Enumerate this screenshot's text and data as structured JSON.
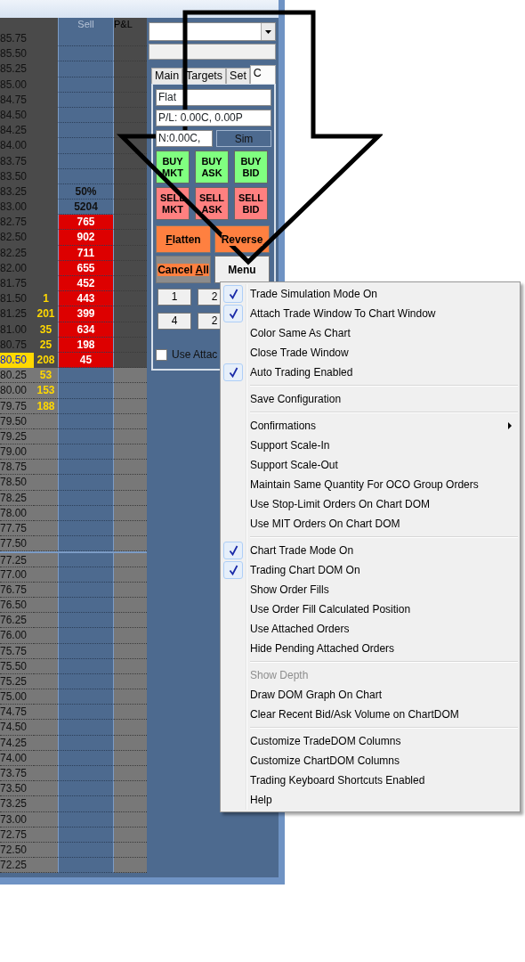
{
  "ladder": {
    "columns": [
      {
        "label": "Sell"
      },
      {
        "label": "P&L"
      }
    ],
    "rows": [
      {
        "price": "85.75",
        "current": false,
        "highlight": false,
        "divider": false
      },
      {
        "price": "85.50",
        "current": false,
        "highlight": false,
        "divider": false
      },
      {
        "price": "85.25",
        "current": false,
        "highlight": false,
        "divider": false
      },
      {
        "price": "85.00",
        "current": false,
        "highlight": false,
        "divider": false
      },
      {
        "price": "84.75",
        "current": false,
        "highlight": false,
        "divider": false
      },
      {
        "price": "84.50",
        "current": false,
        "highlight": false,
        "divider": false
      },
      {
        "price": "84.25",
        "current": false,
        "highlight": false,
        "divider": false
      },
      {
        "price": "84.00",
        "current": false,
        "highlight": false,
        "divider": false
      },
      {
        "price": "83.75",
        "current": false,
        "highlight": false,
        "divider": false
      },
      {
        "price": "83.50",
        "current": false,
        "highlight": false,
        "divider": false
      },
      {
        "price": "83.25",
        "sell": "50%",
        "current": false,
        "highlight": false,
        "divider": false
      },
      {
        "price": "83.00",
        "sell": "5204",
        "current": false,
        "highlight": false,
        "divider": false
      },
      {
        "price": "82.75",
        "sell": "765",
        "current": false,
        "highlight": true,
        "divider": false
      },
      {
        "price": "82.50",
        "sell": "902",
        "current": false,
        "highlight": true,
        "divider": false
      },
      {
        "price": "82.25",
        "sell": "711",
        "current": false,
        "highlight": true,
        "divider": false
      },
      {
        "price": "82.00",
        "sell": "655",
        "current": false,
        "highlight": true,
        "divider": false
      },
      {
        "price": "81.75",
        "sell": "452",
        "current": false,
        "highlight": true,
        "divider": false
      },
      {
        "price": "81.50",
        "bid": "1",
        "sell": "443",
        "current": false,
        "highlight": true,
        "divider": false
      },
      {
        "price": "81.25",
        "bid": "201",
        "sell": "399",
        "current": false,
        "highlight": true,
        "divider": false
      },
      {
        "price": "81.00",
        "bid": "35",
        "sell": "634",
        "current": false,
        "highlight": true,
        "divider": false
      },
      {
        "price": "80.75",
        "bid": "25",
        "sell": "198",
        "current": false,
        "highlight": true,
        "divider": false
      },
      {
        "price": "80.50",
        "bid": "208",
        "sell": "45",
        "current": true,
        "highlight": true,
        "divider": false
      },
      {
        "price": "80.25",
        "bid": "53",
        "current": false,
        "highlight": false,
        "divider": false
      },
      {
        "price": "80.00",
        "bid": "153",
        "current": false,
        "highlight": false,
        "divider": false
      },
      {
        "price": "79.75",
        "bid": "188",
        "current": false,
        "highlight": false,
        "divider": false
      },
      {
        "price": "79.50",
        "current": false,
        "highlight": false,
        "divider": false
      },
      {
        "price": "79.25",
        "current": false,
        "highlight": false,
        "divider": false
      },
      {
        "price": "79.00",
        "current": false,
        "highlight": false,
        "divider": false
      },
      {
        "price": "78.75",
        "current": false,
        "highlight": false,
        "divider": false
      },
      {
        "price": "78.50",
        "current": false,
        "highlight": false,
        "divider": false
      },
      {
        "price": "78.25",
        "current": false,
        "highlight": false,
        "divider": false
      },
      {
        "price": "78.00",
        "current": false,
        "highlight": false,
        "divider": false
      },
      {
        "price": "77.75",
        "current": false,
        "highlight": false,
        "divider": false
      },
      {
        "price": "77.50",
        "current": false,
        "highlight": false,
        "divider": false
      },
      {
        "price": "77.25",
        "current": false,
        "highlight": false,
        "divider": true
      },
      {
        "price": "77.00",
        "current": false,
        "highlight": false,
        "divider": false
      },
      {
        "price": "76.75",
        "current": false,
        "highlight": false,
        "divider": false
      },
      {
        "price": "76.50",
        "current": false,
        "highlight": false,
        "divider": false
      },
      {
        "price": "76.25",
        "current": false,
        "highlight": false,
        "divider": false
      },
      {
        "price": "76.00",
        "current": false,
        "highlight": false,
        "divider": false
      },
      {
        "price": "75.75",
        "current": false,
        "highlight": false,
        "divider": false
      },
      {
        "price": "75.50",
        "current": false,
        "highlight": false,
        "divider": false
      },
      {
        "price": "75.25",
        "current": false,
        "highlight": false,
        "divider": false
      },
      {
        "price": "75.00",
        "current": false,
        "highlight": false,
        "divider": false
      },
      {
        "price": "74.75",
        "current": false,
        "highlight": false,
        "divider": false
      },
      {
        "price": "74.50",
        "current": false,
        "highlight": false,
        "divider": false
      },
      {
        "price": "74.25",
        "current": false,
        "highlight": false,
        "divider": false
      },
      {
        "price": "74.00",
        "current": false,
        "highlight": false,
        "divider": false
      },
      {
        "price": "73.75",
        "current": false,
        "highlight": false,
        "divider": false
      },
      {
        "price": "73.50",
        "current": false,
        "highlight": false,
        "divider": false
      },
      {
        "price": "73.25",
        "current": false,
        "highlight": false,
        "divider": false
      },
      {
        "price": "73.00",
        "current": false,
        "highlight": false,
        "divider": false
      },
      {
        "price": "72.75",
        "current": false,
        "highlight": false,
        "divider": false
      },
      {
        "price": "72.50",
        "current": false,
        "highlight": false,
        "divider": false
      },
      {
        "price": "72.25",
        "current": false,
        "highlight": false,
        "divider": false
      }
    ]
  },
  "trade_window": {
    "tabs": [
      {
        "label": "Main",
        "selected": false
      },
      {
        "label": "Targets",
        "selected": false
      },
      {
        "label": "Set",
        "selected": false
      },
      {
        "label": "C",
        "selected": true
      }
    ],
    "position": "Flat",
    "pl": "P/L: 0.00C, 0.00P",
    "net": "N:0.00C,",
    "mode": "Sim",
    "order_buttons": [
      {
        "label": "BUY MKT",
        "kind": "buy"
      },
      {
        "label": "BUY ASK",
        "kind": "buy"
      },
      {
        "label": "BUY BID",
        "kind": "buy"
      },
      {
        "label": "SELL MKT",
        "kind": "sell"
      },
      {
        "label": "SELL ASK",
        "kind": "sell"
      },
      {
        "label": "SELL BID",
        "kind": "sell"
      }
    ],
    "action_buttons": [
      {
        "parts": [
          {
            "text": "F",
            "underlined": true
          },
          {
            "text": "latten",
            "underlined": false
          }
        ],
        "kind": "orange"
      },
      {
        "parts": [
          {
            "text": "Reverse",
            "underlined": false
          }
        ],
        "kind": "orange"
      },
      {
        "parts": [
          {
            "text": "Cancel ",
            "underlined": false
          },
          {
            "text": "A",
            "underlined": true
          },
          {
            "text": "ll",
            "underlined": false
          }
        ],
        "kind": "cancel"
      },
      {
        "parts": [
          {
            "text": "Menu",
            "underlined": false
          }
        ],
        "kind": "plain"
      }
    ],
    "quantity_buttons": [
      "1",
      "2",
      "4",
      "2"
    ],
    "use_attached": {
      "label": "Use Attac",
      "checked": false
    }
  },
  "menu": {
    "sections": [
      [
        {
          "label": "Trade Simulation Mode On",
          "checked": true,
          "disabled": false,
          "submenu": false
        },
        {
          "label": "Attach Trade Window To Chart Window",
          "checked": true,
          "disabled": false,
          "submenu": false
        },
        {
          "label": "Color Same As Chart",
          "checked": false,
          "disabled": false,
          "submenu": false
        },
        {
          "label": "Close Trade Window",
          "checked": false,
          "disabled": false,
          "submenu": false
        },
        {
          "label": "Auto Trading Enabled",
          "checked": true,
          "disabled": false,
          "submenu": false
        }
      ],
      [
        {
          "label": "Save Configuration",
          "checked": false,
          "disabled": false,
          "submenu": false
        }
      ],
      [
        {
          "label": "Confirmations",
          "checked": false,
          "disabled": false,
          "submenu": true
        },
        {
          "label": "Support Scale-In",
          "checked": false,
          "disabled": false,
          "submenu": false
        },
        {
          "label": "Support Scale-Out",
          "checked": false,
          "disabled": false,
          "submenu": false
        },
        {
          "label": "Maintain Same Quantity For OCO Group Orders",
          "checked": false,
          "disabled": false,
          "submenu": false
        },
        {
          "label": "Use Stop-Limit Orders On Chart DOM",
          "checked": false,
          "disabled": false,
          "submenu": false
        },
        {
          "label": "Use MIT Orders On Chart DOM",
          "checked": false,
          "disabled": false,
          "submenu": false
        }
      ],
      [
        {
          "label": "Chart Trade Mode On",
          "checked": true,
          "disabled": false,
          "submenu": false
        },
        {
          "label": "Trading Chart DOM On",
          "checked": true,
          "disabled": false,
          "submenu": false
        },
        {
          "label": "Show Order Fills",
          "checked": false,
          "disabled": false,
          "submenu": false
        },
        {
          "label": "Use Order Fill Calculated Position",
          "checked": false,
          "disabled": false,
          "submenu": false
        },
        {
          "label": "Use Attached Orders",
          "checked": false,
          "disabled": false,
          "submenu": false
        },
        {
          "label": "Hide Pending Attached Orders",
          "checked": false,
          "disabled": false,
          "submenu": false
        }
      ],
      [
        {
          "label": "Show Depth",
          "checked": false,
          "disabled": true,
          "submenu": false
        },
        {
          "label": "Draw DOM Graph On Chart",
          "checked": false,
          "disabled": false,
          "submenu": false
        },
        {
          "label": "Clear Recent Bid/Ask Volume on ChartDOM",
          "checked": false,
          "disabled": false,
          "submenu": false
        }
      ],
      [
        {
          "label": "Customize TradeDOM Columns",
          "checked": false,
          "disabled": false,
          "submenu": false
        },
        {
          "label": "Customize ChartDOM Columns",
          "checked": false,
          "disabled": false,
          "submenu": false
        },
        {
          "label": "Trading Keyboard Shortcuts Enabled",
          "checked": false,
          "disabled": false,
          "submenu": false
        },
        {
          "label": "Help",
          "checked": false,
          "disabled": false,
          "submenu": false
        }
      ]
    ]
  }
}
